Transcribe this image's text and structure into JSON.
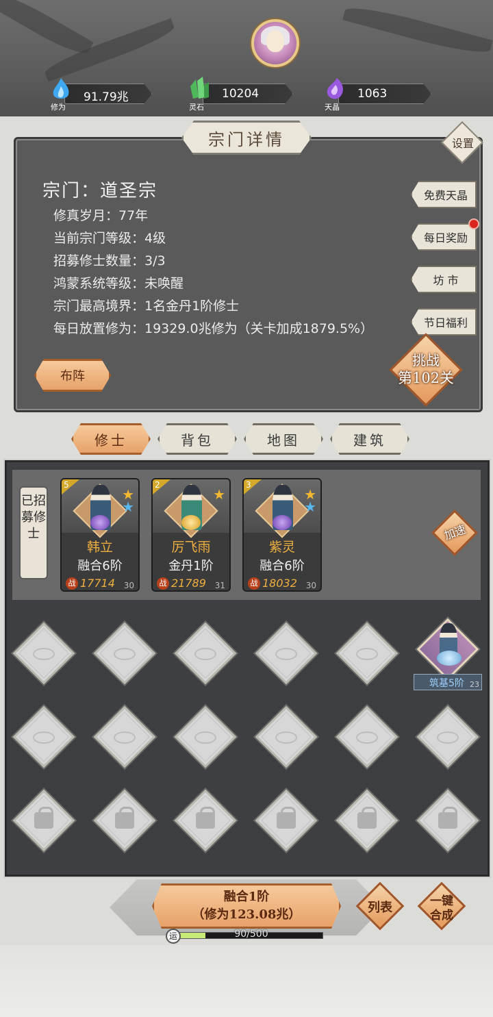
{
  "resources": [
    {
      "icon": "blue-flame-icon",
      "label": "修为",
      "value": "91.79兆",
      "color": "#3ea8f0"
    },
    {
      "icon": "green-crystal-icon",
      "label": "灵石",
      "value": "10204",
      "color": "#5ec86a"
    },
    {
      "icon": "purple-crystal-icon",
      "label": "天晶",
      "value": "1063",
      "color": "#9a5ae0"
    }
  ],
  "panel": {
    "title": "宗门详情",
    "settings": "设置",
    "sect_name": "宗门：道圣宗",
    "info": [
      "修真岁月：77年",
      "当前宗门等级：4级",
      "招募修士数量：3/3",
      "鸿蒙系统等级：未唤醒",
      "宗门最高境界：1名金丹1阶修士",
      "每日放置修为：19329.0兆修为（关卡加成1879.5%）"
    ],
    "side_buttons": [
      "免费天晶",
      "每日奖励",
      "坊 市",
      "节日福利"
    ],
    "formation": "布阵",
    "challenge_line1": "挑战",
    "challenge_line2": "第102关"
  },
  "tabs": [
    "修士",
    "背包",
    "地图",
    "建筑"
  ],
  "recruited": {
    "label": "已招募修士",
    "speedup": "加速",
    "cards": [
      {
        "level": "5",
        "name": "韩立",
        "rank": "融合6阶",
        "power": "17714",
        "count": "30",
        "stars": 2,
        "orb": "#8a5ad0"
      },
      {
        "level": "2",
        "name": "厉飞雨",
        "rank": "金丹1阶",
        "power": "21789",
        "count": "31",
        "stars": 1,
        "orb": "#e8b030"
      },
      {
        "level": "3",
        "name": "紫灵",
        "rank": "融合6阶",
        "power": "18032",
        "count": "30",
        "stars": 2,
        "orb": "#8a5ad0"
      }
    ],
    "power_badge": "战"
  },
  "hero_slot": {
    "rank": "筑基5阶",
    "count": "23"
  },
  "bottom": {
    "merge_line1": "融合1阶",
    "merge_line2": "（修为123.08兆）",
    "list": "列表",
    "auto_merge_1": "一键",
    "auto_merge_2": "合成",
    "luck_icon": "运",
    "luck_text": "90/500",
    "luck_progress": 0.18
  }
}
